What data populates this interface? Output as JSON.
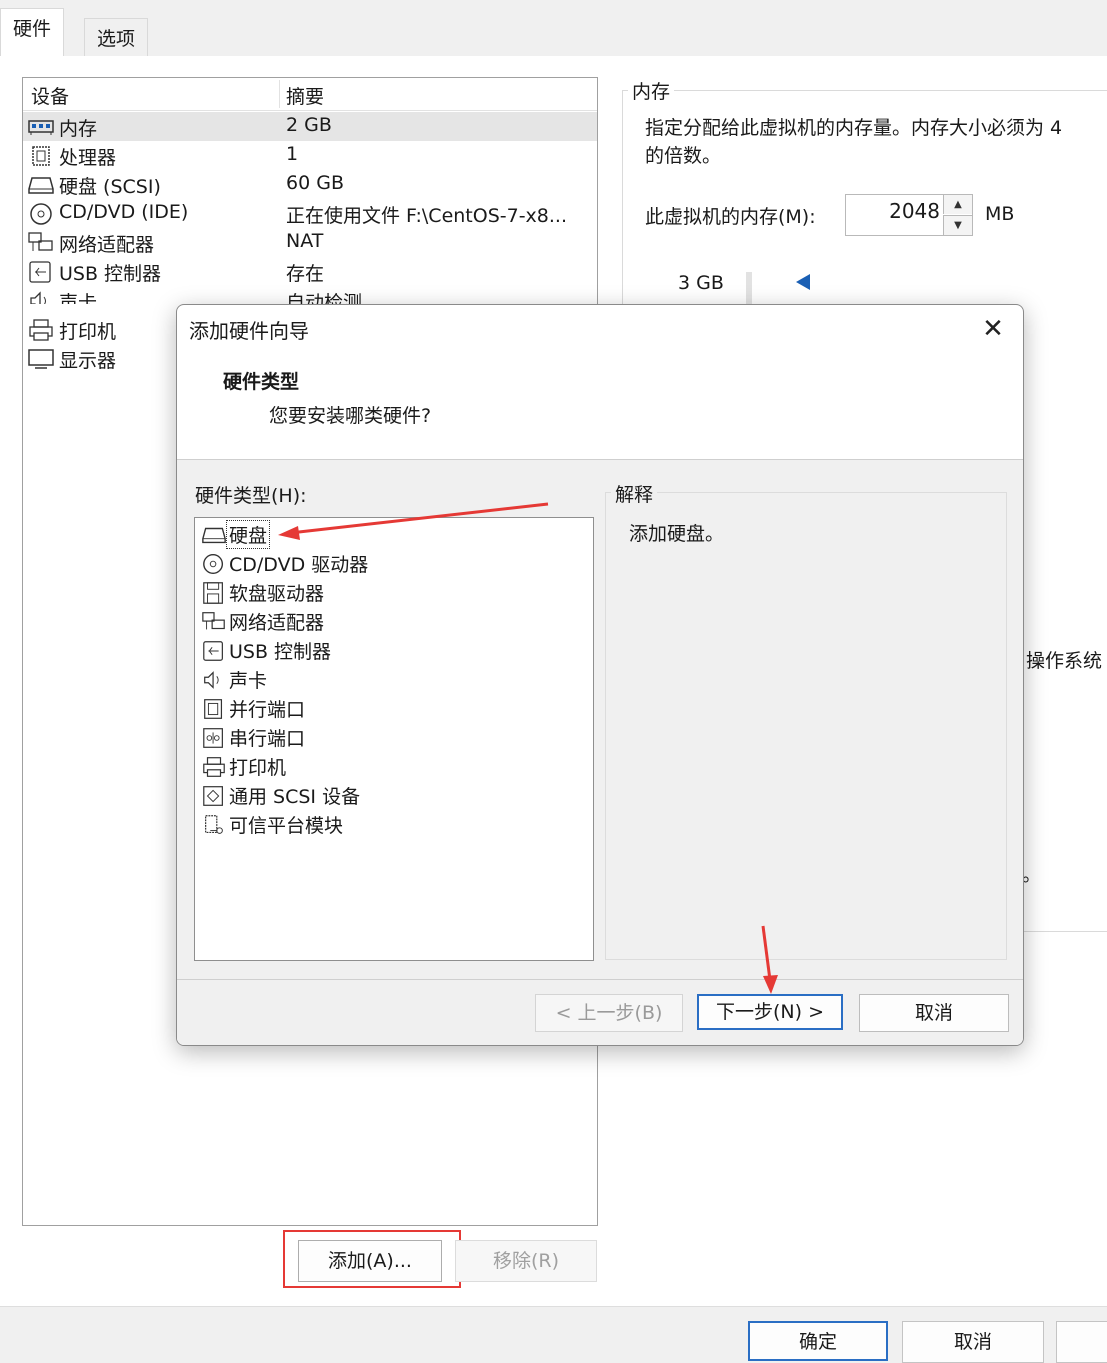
{
  "tabs": [
    {
      "label": "硬件",
      "active": true
    },
    {
      "label": "选项",
      "active": false
    }
  ],
  "device_table": {
    "headers": [
      "设备",
      "摘要"
    ],
    "rows": [
      {
        "icon": "memory-icon",
        "name": "内存",
        "summary": "2 GB",
        "selected": true
      },
      {
        "icon": "cpu-icon",
        "name": "处理器",
        "summary": "1"
      },
      {
        "icon": "hard-disk-icon",
        "name": "硬盘 (SCSI)",
        "summary": "60 GB"
      },
      {
        "icon": "cd-dvd-icon",
        "name": "CD/DVD (IDE)",
        "summary": "正在使用文件 F:\\CentOS-7-x8..."
      },
      {
        "icon": "network-adapter-icon",
        "name": "网络适配器",
        "summary": "NAT"
      },
      {
        "icon": "usb-icon",
        "name": "USB 控制器",
        "summary": "存在"
      },
      {
        "icon": "sound-icon",
        "name": "声卡",
        "summary": "自动检测"
      },
      {
        "icon": "printer-icon",
        "name": "打印机",
        "summary": ""
      },
      {
        "icon": "display-icon",
        "name": "显示器",
        "summary": ""
      }
    ]
  },
  "memory": {
    "legend": "内存",
    "description_line1": "指定分配给此虚拟机的内存量。内存大小必须为 4",
    "description_line2": "的倍数。",
    "label": "此虚拟机的内存(M):",
    "value": "2048",
    "unit": "MB",
    "scale_label": "3 GB",
    "os_text": "操作系统",
    "period": "。"
  },
  "buttons": {
    "add": "添加(A)...",
    "remove": "移除(R)",
    "ok": "确定",
    "cancel": "取消"
  },
  "dialog": {
    "title": "添加硬件向导",
    "heading": "硬件类型",
    "subheading": "您要安装哪类硬件?",
    "list_label": "硬件类型(H):",
    "hardware_types": [
      {
        "icon": "hard-disk-icon",
        "label": "硬盘",
        "selected": true
      },
      {
        "icon": "cd-dvd-icon",
        "label": "CD/DVD 驱动器"
      },
      {
        "icon": "floppy-icon",
        "label": "软盘驱动器"
      },
      {
        "icon": "network-adapter-icon",
        "label": "网络适配器"
      },
      {
        "icon": "usb-icon",
        "label": "USB 控制器"
      },
      {
        "icon": "sound-icon",
        "label": "声卡"
      },
      {
        "icon": "parallel-port-icon",
        "label": "并行端口"
      },
      {
        "icon": "serial-port-icon",
        "label": "串行端口"
      },
      {
        "icon": "printer-icon",
        "label": "打印机"
      },
      {
        "icon": "scsi-device-icon",
        "label": "通用 SCSI 设备"
      },
      {
        "icon": "tpm-icon",
        "label": "可信平台模块"
      }
    ],
    "explanation_legend": "解释",
    "explanation_text": "添加硬盘。",
    "back": "< 上一步(B)",
    "next": "下一步(N) >",
    "cancel": "取消"
  },
  "colors": {
    "accent": "#2a6ec4",
    "annotation": "#e53935",
    "selection": "#e5e5e5"
  }
}
